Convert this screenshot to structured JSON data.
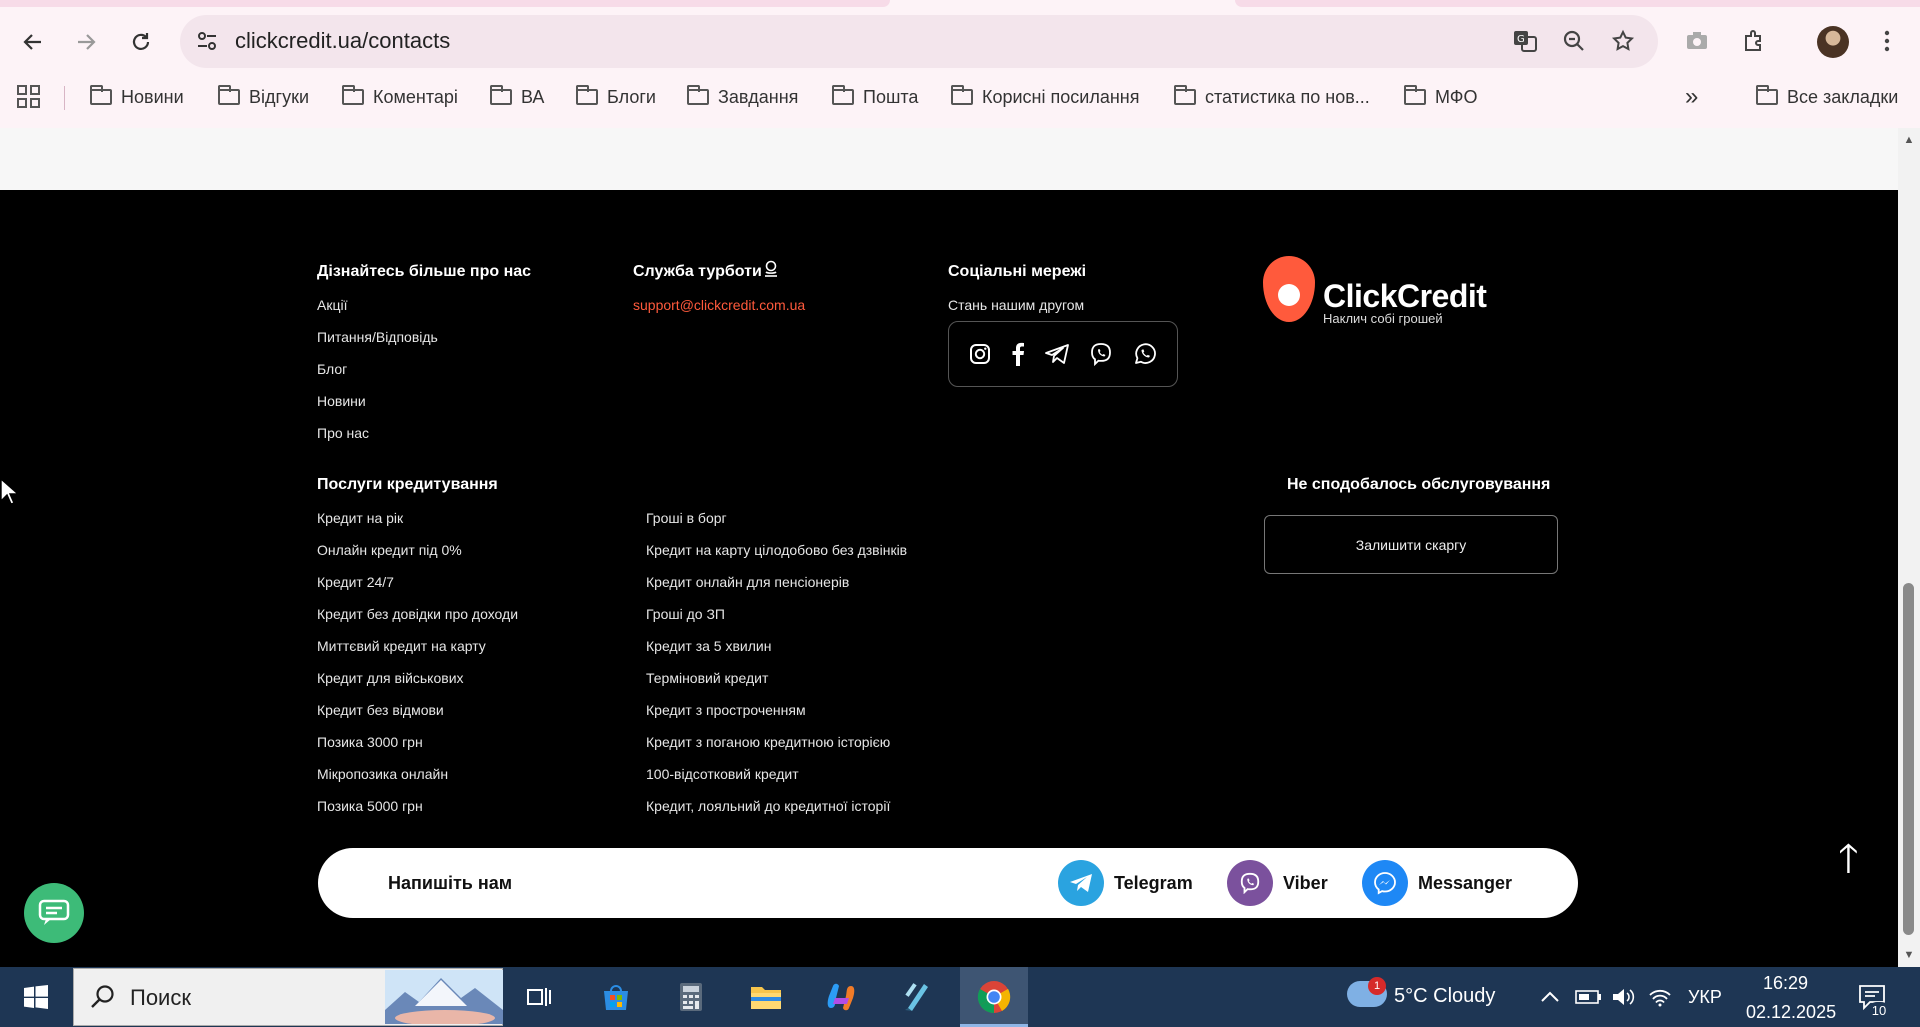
{
  "browser": {
    "url": "clickcredit.ua/contacts",
    "bookmarks": [
      "Новини",
      "Відгуки",
      "Коментарі",
      "ВА",
      "Блоги",
      "Завдання",
      "Пошта",
      "Корисні посилання",
      "статистика по нов...",
      "МФО"
    ],
    "all_bookmarks": "Все закладки",
    "more_icon": "»"
  },
  "footer": {
    "learn_more": {
      "title": "Дізнайтесь більше про нас",
      "links": [
        "Акції",
        "Питання/Відповідь",
        "Блог",
        "Новини",
        "Про нас"
      ]
    },
    "support": {
      "title": "Служба турботи",
      "email": "support@clickcredit.com.ua"
    },
    "social": {
      "title": "Соціальні мережі",
      "subtitle": "Стань нашим другом",
      "icons": [
        "instagram-icon",
        "facebook-icon",
        "telegram-icon",
        "viber-icon",
        "whatsapp-icon"
      ]
    },
    "brand": {
      "name": "ClickCredit",
      "tagline": "Наклич собі грошей"
    },
    "services": {
      "title": "Послуги кредитування",
      "col1": [
        "Кредит на рік",
        "Онлайн кредит під 0%",
        "Кредит 24/7",
        "Кредит без довідки про доходи",
        "Миттєвий кредит на карту",
        "Кредит для військових",
        "Кредит без відмови",
        "Позика 3000 грн",
        "Мікропозика онлайн",
        "Позика 5000 грн"
      ],
      "col2": [
        "Гроші в борг",
        "Кредит на карту цілодобово без дзвінків",
        "Кредит онлайн для пенсіонерів",
        "Гроші до ЗП",
        "Кредит за 5 хвилин",
        "Терміновий кредит",
        "Кредит з простроченням",
        "Кредит з поганою кредитною історією",
        "100-відсотковий кредит",
        "Кредит, лояльний до кредитної історії"
      ]
    },
    "complaint": {
      "title": "Не сподобалось обслуговування",
      "button": "Залишити скаргу"
    },
    "write_us": {
      "title": "Напишіть нам",
      "messengers": [
        {
          "label": "Telegram",
          "color": "#2aa3e0"
        },
        {
          "label": "Viber",
          "color": "#7b519d"
        },
        {
          "label": "Messanger",
          "color": "#1e88f5"
        }
      ]
    }
  },
  "taskbar": {
    "search_placeholder": "Поиск",
    "weather": "5°C  Cloudy",
    "weather_badge": "1",
    "language": "УКР",
    "time": "16:29",
    "date": "02.12.2025",
    "notifications": "10"
  },
  "colors": {
    "accent": "#ff5a3c",
    "footer_bg": "#000000",
    "chat": "#3dbb78"
  }
}
